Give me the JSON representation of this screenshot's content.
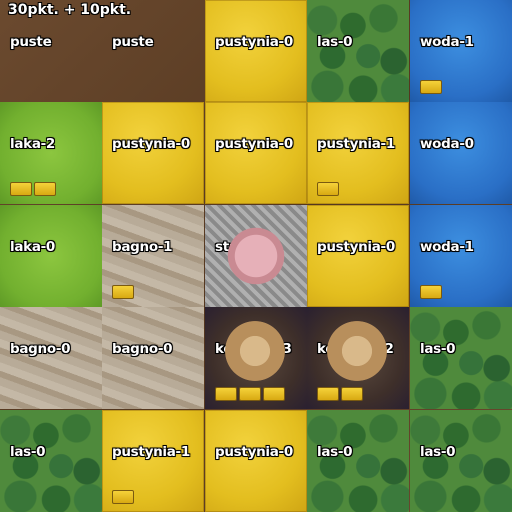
{
  "score": "30pkt. + 10pkt.",
  "grid": [
    [
      {
        "type": "empty",
        "label": "puste"
      },
      {
        "type": "empty",
        "label": "puste"
      },
      {
        "type": "desert",
        "label": "pustynia-0"
      },
      {
        "type": "forest",
        "label": "las-0"
      },
      {
        "type": "water",
        "label": "woda-1"
      }
    ],
    [
      {
        "type": "meadow",
        "label": "laka-2"
      },
      {
        "type": "desert",
        "label": "pustynia-0"
      },
      {
        "type": "desert",
        "label": "pustynia-0"
      },
      {
        "type": "desert",
        "label": "pustynia-1"
      },
      {
        "type": "water",
        "label": "woda-0"
      }
    ],
    [
      {
        "type": "meadow",
        "label": "laka-0"
      },
      {
        "type": "swamp",
        "label": "bagno-1"
      },
      {
        "type": "start",
        "label": "startowy"
      },
      {
        "type": "desert",
        "label": "pustynia-0"
      },
      {
        "type": "water",
        "label": "woda-1"
      }
    ],
    [
      {
        "type": "swamp",
        "label": "bagno-0"
      },
      {
        "type": "swamp",
        "label": "bagno-0"
      },
      {
        "type": "mine",
        "label": "kopalnia-3"
      },
      {
        "type": "mine",
        "label": "kopalnia-2"
      },
      {
        "type": "forest",
        "label": "las-0"
      }
    ],
    [
      {
        "type": "forest",
        "label": "las-0"
      },
      {
        "type": "desert",
        "label": "pustynia-1"
      },
      {
        "type": "desert",
        "label": "pustynia-0"
      },
      {
        "type": "forest",
        "label": "las-0"
      },
      {
        "type": "forest",
        "label": "las-0"
      }
    ]
  ]
}
